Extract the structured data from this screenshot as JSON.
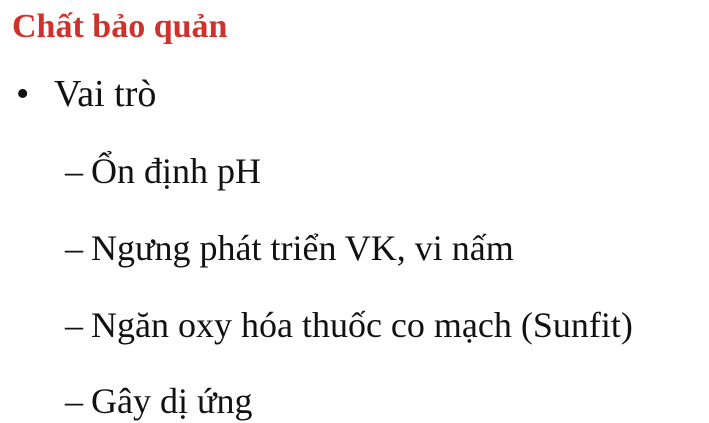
{
  "slide": {
    "title": "Chất bảo quản",
    "title_color": "#d0312d",
    "bullet": {
      "marker": "•",
      "text": "Vai trò"
    },
    "sub_items": [
      {
        "marker": "–",
        "text": "Ổn định pH"
      },
      {
        "marker": "–",
        "text": "Ngưng phát triển VK, vi nấm"
      },
      {
        "marker": "–",
        "text": "Ngăn oxy hóa thuốc co mạch (Sunfit)"
      },
      {
        "marker": "–",
        "text": "Gây dị ứng"
      }
    ]
  }
}
